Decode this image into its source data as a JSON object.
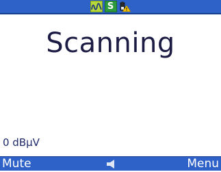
{
  "status_bar": {
    "icons": [
      "wave-icon",
      "s-badge-icon",
      "battery-warning-icon"
    ],
    "s_badge_text": "S"
  },
  "main": {
    "title": "Scanning",
    "signal_level": "0 dBµV"
  },
  "bottom_bar": {
    "left_softkey": "Mute",
    "center_icon": "speaker-icon",
    "right_softkey": "Menu"
  },
  "colors": {
    "bar_blue": "#2f62c8",
    "title_text": "#1b1b44",
    "background": "#ffffff"
  }
}
